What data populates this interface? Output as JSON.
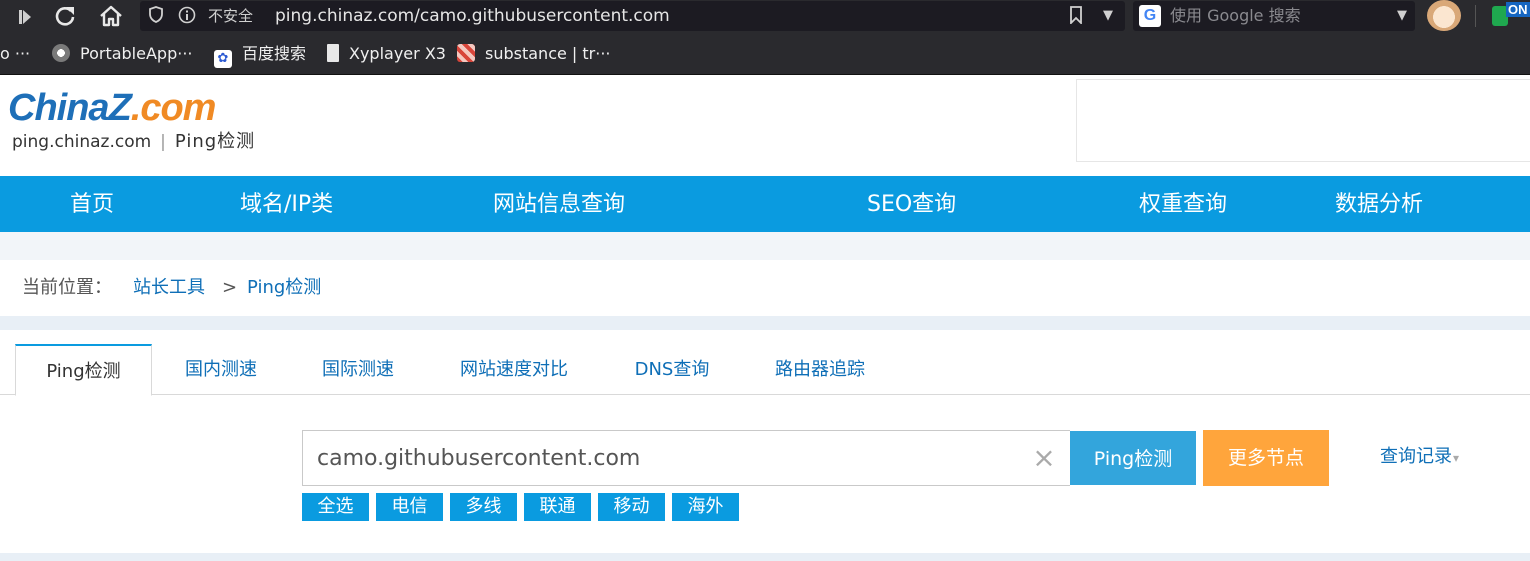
{
  "browser": {
    "security_label": "不安全",
    "url": "ping.chinaz.com/camo.githubusercontent.com",
    "search_placeholder": "使用 Google 搜索",
    "extension_badge": "ON",
    "bookmarks": [
      {
        "label": "o ···",
        "icon": "folder-icon"
      },
      {
        "label": "PortableApp···",
        "icon": "portableapps-icon"
      },
      {
        "label": "百度搜索",
        "icon": "baidu-paw-icon"
      },
      {
        "label": "Xyplayer X3",
        "icon": "page-icon"
      },
      {
        "label": "substance | tr···",
        "icon": "substance-icon"
      }
    ]
  },
  "logo": {
    "china": "China",
    "z": "Z",
    "com": ".com",
    "domain": "ping.chinaz.com",
    "separator": "|",
    "tool": "Ping检测"
  },
  "nav": [
    {
      "label": "首页"
    },
    {
      "label": "域名/IP类"
    },
    {
      "label": "网站信息查询"
    },
    {
      "label": "SEO查询"
    },
    {
      "label": "权重查询"
    },
    {
      "label": "数据分析"
    }
  ],
  "breadcrumb": {
    "label": "当前位置：",
    "home": "站长工具",
    "separator": ">",
    "current": "Ping检测"
  },
  "tabs": [
    {
      "label": "Ping检测",
      "active": true
    },
    {
      "label": "国内测速",
      "active": false
    },
    {
      "label": "国际测速",
      "active": false
    },
    {
      "label": "网站速度对比",
      "active": false
    },
    {
      "label": "DNS查询",
      "active": false
    },
    {
      "label": "路由器追踪",
      "active": false
    }
  ],
  "search": {
    "value": "camo.githubusercontent.com",
    "clear_symbol": "×",
    "ping_button": "Ping检测",
    "more_nodes_button": "更多节点",
    "history_link": "查询记录",
    "history_caret": "▾"
  },
  "filters": [
    {
      "label": "全选"
    },
    {
      "label": "电信"
    },
    {
      "label": "多线"
    },
    {
      "label": "联通"
    },
    {
      "label": "移动"
    },
    {
      "label": "海外"
    }
  ],
  "colors": {
    "nav_blue": "#0a9be0",
    "link_blue": "#0f6fb7",
    "ping_button": "#33a5dc",
    "more_button": "#ffa53c",
    "logo_blue": "#1e6fb8",
    "logo_orange": "#f08a24"
  }
}
